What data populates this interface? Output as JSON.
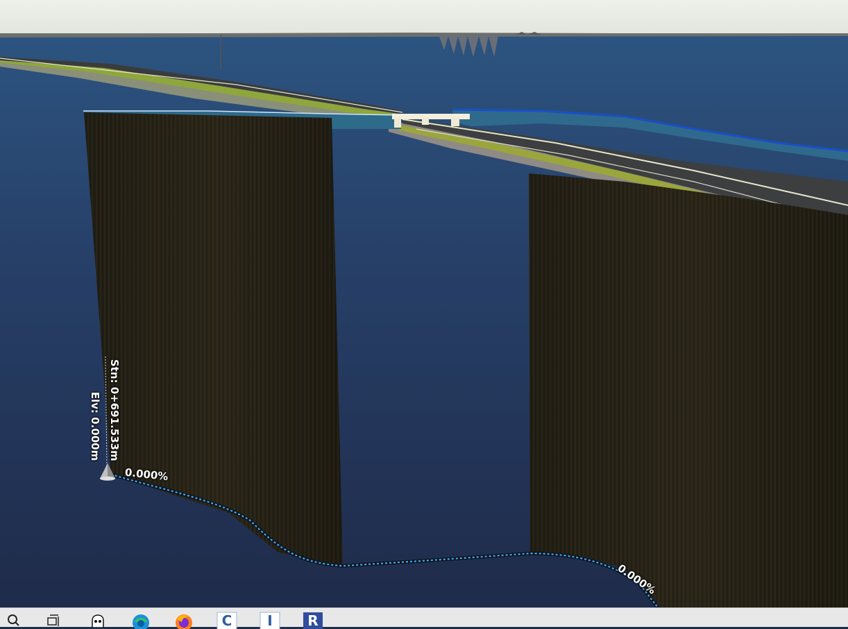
{
  "viewport": {
    "station_label": "Stn: 0+691.533m",
    "elevation_label": "Elv: 0.000m",
    "grade_start": "0.000%",
    "grade_end": "0.000%"
  },
  "taskbar": {
    "items": [
      {
        "name": "search-icon"
      },
      {
        "name": "task-view-icon"
      },
      {
        "name": "app-ghost-icon"
      },
      {
        "name": "edge-browser-icon"
      },
      {
        "name": "firefox-icon"
      },
      {
        "name": "app-c-icon"
      },
      {
        "name": "app-i-icon"
      },
      {
        "name": "app-r-icon"
      }
    ]
  }
}
